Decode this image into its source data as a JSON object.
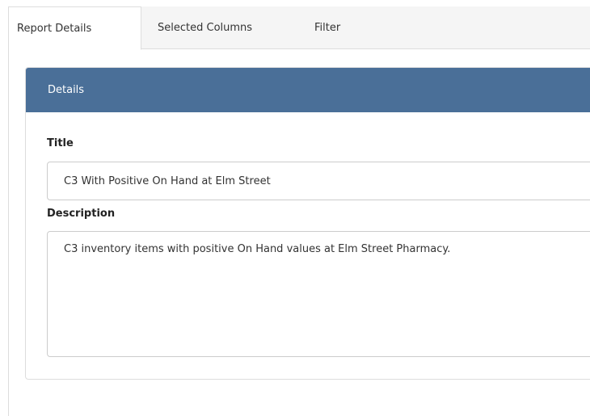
{
  "tabs": [
    {
      "label": "Report Details",
      "active": true
    },
    {
      "label": "Selected Columns",
      "active": false
    },
    {
      "label": "Filter",
      "active": false
    }
  ],
  "panel": {
    "heading": "Details",
    "accent_color": "#4a6f98"
  },
  "form": {
    "title_label": "Title",
    "title_value": "C3 With Positive On Hand at Elm Street",
    "description_label": "Description",
    "description_value": "C3 inventory items with positive On Hand values at Elm Street Pharmacy."
  }
}
